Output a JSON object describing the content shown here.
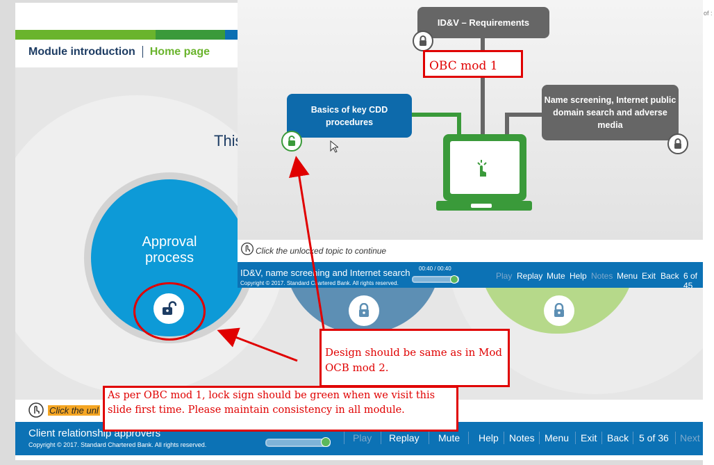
{
  "base_slide": {
    "nav": {
      "module_intro": "Module introduction",
      "home_page": "Home page"
    },
    "heading_fragment": "This",
    "approval_label": "Approval process",
    "hint_text": "Click the unl",
    "footer": {
      "title": "Client relationship approvers",
      "copyright": "Copyright © 2017. Standard Chartered Bank. All rights reserved.",
      "progress": 0.9,
      "controls": {
        "play": "Play",
        "replay": "Replay",
        "mute": "Mute",
        "help": "Help",
        "notes": "Notes",
        "menu": "Menu",
        "exit": "Exit",
        "back": "Back",
        "page": "5 of 36",
        "next": "Next"
      }
    }
  },
  "overlay_slide": {
    "idv_requirements": "ID&V – Requirements",
    "basics_cdd": "Basics of key CDD procedures",
    "name_screening": "Name screening, Internet public domain search and adverse media",
    "hint_text": "Click the unlocked topic to continue",
    "footer": {
      "title": "ID&V, name screening and Internet search",
      "copyright": "Copyright © 2017. Standard Chartered Bank. All rights reserved.",
      "time": "00:40 / 00:40",
      "progress": 1.0,
      "controls": {
        "play": "Play",
        "replay": "Replay",
        "mute": "Mute",
        "help": "Help",
        "notes": "Notes",
        "menu": "Menu",
        "exit": "Exit",
        "back": "Back",
        "page": "6 of 45"
      }
    }
  },
  "annotations": {
    "obc_mod": "OBC mod 1",
    "design_note": "Design should be same as in Mod OCB mod 2.",
    "lock_note": "As per OBC mod 1, lock sign should be green when we visit this slide first time. Please maintain consistency in all module."
  },
  "edge_text": "of :",
  "colors": {
    "annotation_red": "#e00000",
    "footer_blue": "#0c72b5",
    "brand_green": "#6ab42d",
    "approval_blue": "#0d9ad7"
  }
}
